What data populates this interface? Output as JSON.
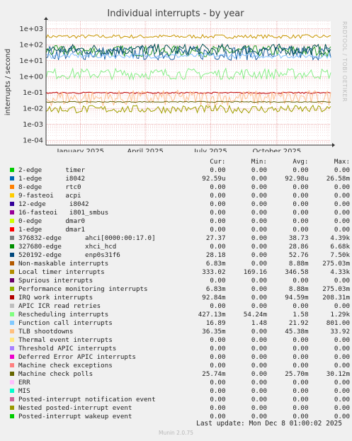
{
  "chart_data": {
    "type": "line",
    "title": "Individual interrupts - by year",
    "ylabel": "interrupts / second",
    "yscale": "log",
    "ylim": [
      5e-05,
      3000
    ],
    "y_ticks": [
      0.0001,
      0.001,
      0.01,
      0.1,
      1,
      10,
      100,
      1000
    ],
    "y_tick_labels": [
      "1e-04",
      "1e-03",
      "1e-02",
      "1e-01",
      "1e+00",
      "1e+01",
      "1e+02",
      "1e+03"
    ],
    "x_range": [
      "2024-11-14",
      "2025-12-15"
    ],
    "x_ticks": [
      "2025-01-01",
      "2025-04-01",
      "2025-07-01",
      "2025-10-01"
    ],
    "x_tick_labels": [
      "January 2025",
      "April 2025",
      "July 2025",
      "October 2025"
    ],
    "grid": true,
    "side_label": "RRDTOOL / TOBI OETIKER",
    "series": [
      {
        "name": "Local timer interrupts",
        "color": "#c89600",
        "level": 330,
        "noise": 0.12
      },
      {
        "name": "ahci[0000:00:17.0]",
        "color": "#2ca02c",
        "level": 40,
        "noise": 0.35
      },
      {
        "name": "xhci_hcd",
        "color": "#1f5f9f",
        "level": 30,
        "noise": 0.45
      },
      {
        "name": "enp0s31f6",
        "color": "#005050",
        "level": 50,
        "noise": 0.35
      },
      {
        "name": "Function call interrupts",
        "color": "#80c0ff",
        "level": 20,
        "noise": 0.15
      },
      {
        "name": "Rescheduling interrupts",
        "color": "#88ee88",
        "level": 1.5,
        "noise": 0.35
      },
      {
        "name": "IRQ work interrupts",
        "color": "#c00000",
        "level": 0.095,
        "noise": 0.05
      },
      {
        "name": "TLB shootdowns",
        "color": "#ffc090",
        "level": 0.045,
        "noise": 0.5
      },
      {
        "name": "Machine check polls",
        "color": "#606000",
        "level": 0.026,
        "noise": 0.03
      },
      {
        "name": "Nested posted-interrupt event",
        "color": "#a0a000",
        "level": 0.009,
        "noise": 0.25
      }
    ]
  },
  "legend": {
    "headers": {
      "cur": "Cur:",
      "min": "Min:",
      "avg": "Avg:",
      "max": "Max:"
    },
    "rows": [
      {
        "name": "2-edge      timer",
        "color": "#00cc00",
        "cur": "0.00",
        "min": "0.00",
        "avg": "0.00",
        "max": "0.00"
      },
      {
        "name": "1-edge      i8042",
        "color": "#0066b3",
        "cur": "92.59u",
        "min": "0.00",
        "avg": "92.98u",
        "max": "26.58m"
      },
      {
        "name": "8-edge      rtc0",
        "color": "#ff8000",
        "cur": "0.00",
        "min": "0.00",
        "avg": "0.00",
        "max": "0.00"
      },
      {
        "name": "9-fasteoi   acpi",
        "color": "#ffcc00",
        "cur": "0.00",
        "min": "0.00",
        "avg": "0.00",
        "max": "0.00"
      },
      {
        "name": "12-edge      i8042",
        "color": "#330099",
        "cur": "0.00",
        "min": "0.00",
        "avg": "0.00",
        "max": "0.00"
      },
      {
        "name": "16-fasteoi   i801_smbus",
        "color": "#990099",
        "cur": "0.00",
        "min": "0.00",
        "avg": "0.00",
        "max": "0.00"
      },
      {
        "name": "0-edge      dmar0",
        "color": "#ccff00",
        "cur": "0.00",
        "min": "0.00",
        "avg": "0.00",
        "max": "0.00"
      },
      {
        "name": "1-edge      dmar1",
        "color": "#ff0000",
        "cur": "0.00",
        "min": "0.00",
        "avg": "0.00",
        "max": "0.00"
      },
      {
        "name": "376832-edge      ahci[0000:00:17.0]",
        "color": "#808080",
        "cur": "27.37",
        "min": "0.00",
        "avg": "38.73",
        "max": "4.39k"
      },
      {
        "name": "327680-edge      xhci_hcd",
        "color": "#008f00",
        "cur": "0.00",
        "min": "0.00",
        "avg": "28.86",
        "max": "6.68k"
      },
      {
        "name": "520192-edge      enp0s31f6",
        "color": "#00487d",
        "cur": "28.18",
        "min": "0.00",
        "avg": "52.76",
        "max": "7.50k"
      },
      {
        "name": "Non-maskable interrupts",
        "color": "#b35a00",
        "cur": "6.83m",
        "min": "0.00",
        "avg": "8.88m",
        "max": "275.03m"
      },
      {
        "name": "Local timer interrupts",
        "color": "#b38f00",
        "cur": "333.02",
        "min": "169.16",
        "avg": "346.58",
        "max": "4.33k"
      },
      {
        "name": "Spurious interrupts",
        "color": "#6b006b",
        "cur": "0.00",
        "min": "0.00",
        "avg": "0.00",
        "max": "0.00"
      },
      {
        "name": "Performance monitoring interrupts",
        "color": "#8fb300",
        "cur": "6.83m",
        "min": "0.00",
        "avg": "8.88m",
        "max": "275.03m"
      },
      {
        "name": "IRQ work interrupts",
        "color": "#b30000",
        "cur": "92.84m",
        "min": "0.00",
        "avg": "94.59m",
        "max": "208.31m"
      },
      {
        "name": "APIC ICR read retries",
        "color": "#bebebe",
        "cur": "0.00",
        "min": "0.00",
        "avg": "0.00",
        "max": "0.00"
      },
      {
        "name": "Rescheduling interrupts",
        "color": "#80ff80",
        "cur": "427.13m",
        "min": "54.24m",
        "avg": "1.58",
        "max": "1.29k"
      },
      {
        "name": "Function call interrupts",
        "color": "#80c9ff",
        "cur": "16.89",
        "min": "1.48",
        "avg": "21.92",
        "max": "801.00"
      },
      {
        "name": "TLB shootdowns",
        "color": "#ffc080",
        "cur": "36.35m",
        "min": "0.00",
        "avg": "45.38m",
        "max": "33.92"
      },
      {
        "name": "Thermal event interrupts",
        "color": "#ffe680",
        "cur": "0.00",
        "min": "0.00",
        "avg": "0.00",
        "max": "0.00"
      },
      {
        "name": "Threshold APIC interrupts",
        "color": "#aa80ff",
        "cur": "0.00",
        "min": "0.00",
        "avg": "0.00",
        "max": "0.00"
      },
      {
        "name": "Deferred Error APIC interrupts",
        "color": "#ee00cc",
        "cur": "0.00",
        "min": "0.00",
        "avg": "0.00",
        "max": "0.00"
      },
      {
        "name": "Machine check exceptions",
        "color": "#ff8080",
        "cur": "0.00",
        "min": "0.00",
        "avg": "0.00",
        "max": "0.00"
      },
      {
        "name": "Machine check polls",
        "color": "#666600",
        "cur": "25.74m",
        "min": "0.00",
        "avg": "25.70m",
        "max": "30.12m"
      },
      {
        "name": "ERR",
        "color": "#ffbfff",
        "cur": "0.00",
        "min": "0.00",
        "avg": "0.00",
        "max": "0.00"
      },
      {
        "name": "MIS",
        "color": "#00ffcc",
        "cur": "0.00",
        "min": "0.00",
        "avg": "0.00",
        "max": "0.00"
      },
      {
        "name": "Posted-interrupt notification event",
        "color": "#cc6699",
        "cur": "0.00",
        "min": "0.00",
        "avg": "0.00",
        "max": "0.00"
      },
      {
        "name": "Nested posted-interrupt event",
        "color": "#999900",
        "cur": "0.00",
        "min": "0.00",
        "avg": "0.00",
        "max": "0.00"
      },
      {
        "name": "Posted-interrupt wakeup event",
        "color": "#00cc00",
        "cur": "0.00",
        "min": "0.00",
        "avg": "0.00",
        "max": "0.00"
      }
    ]
  },
  "footer": {
    "last_update": "Last update: Mon Dec  8 01:00:02 2025",
    "version": "Munin 2.0.75"
  }
}
